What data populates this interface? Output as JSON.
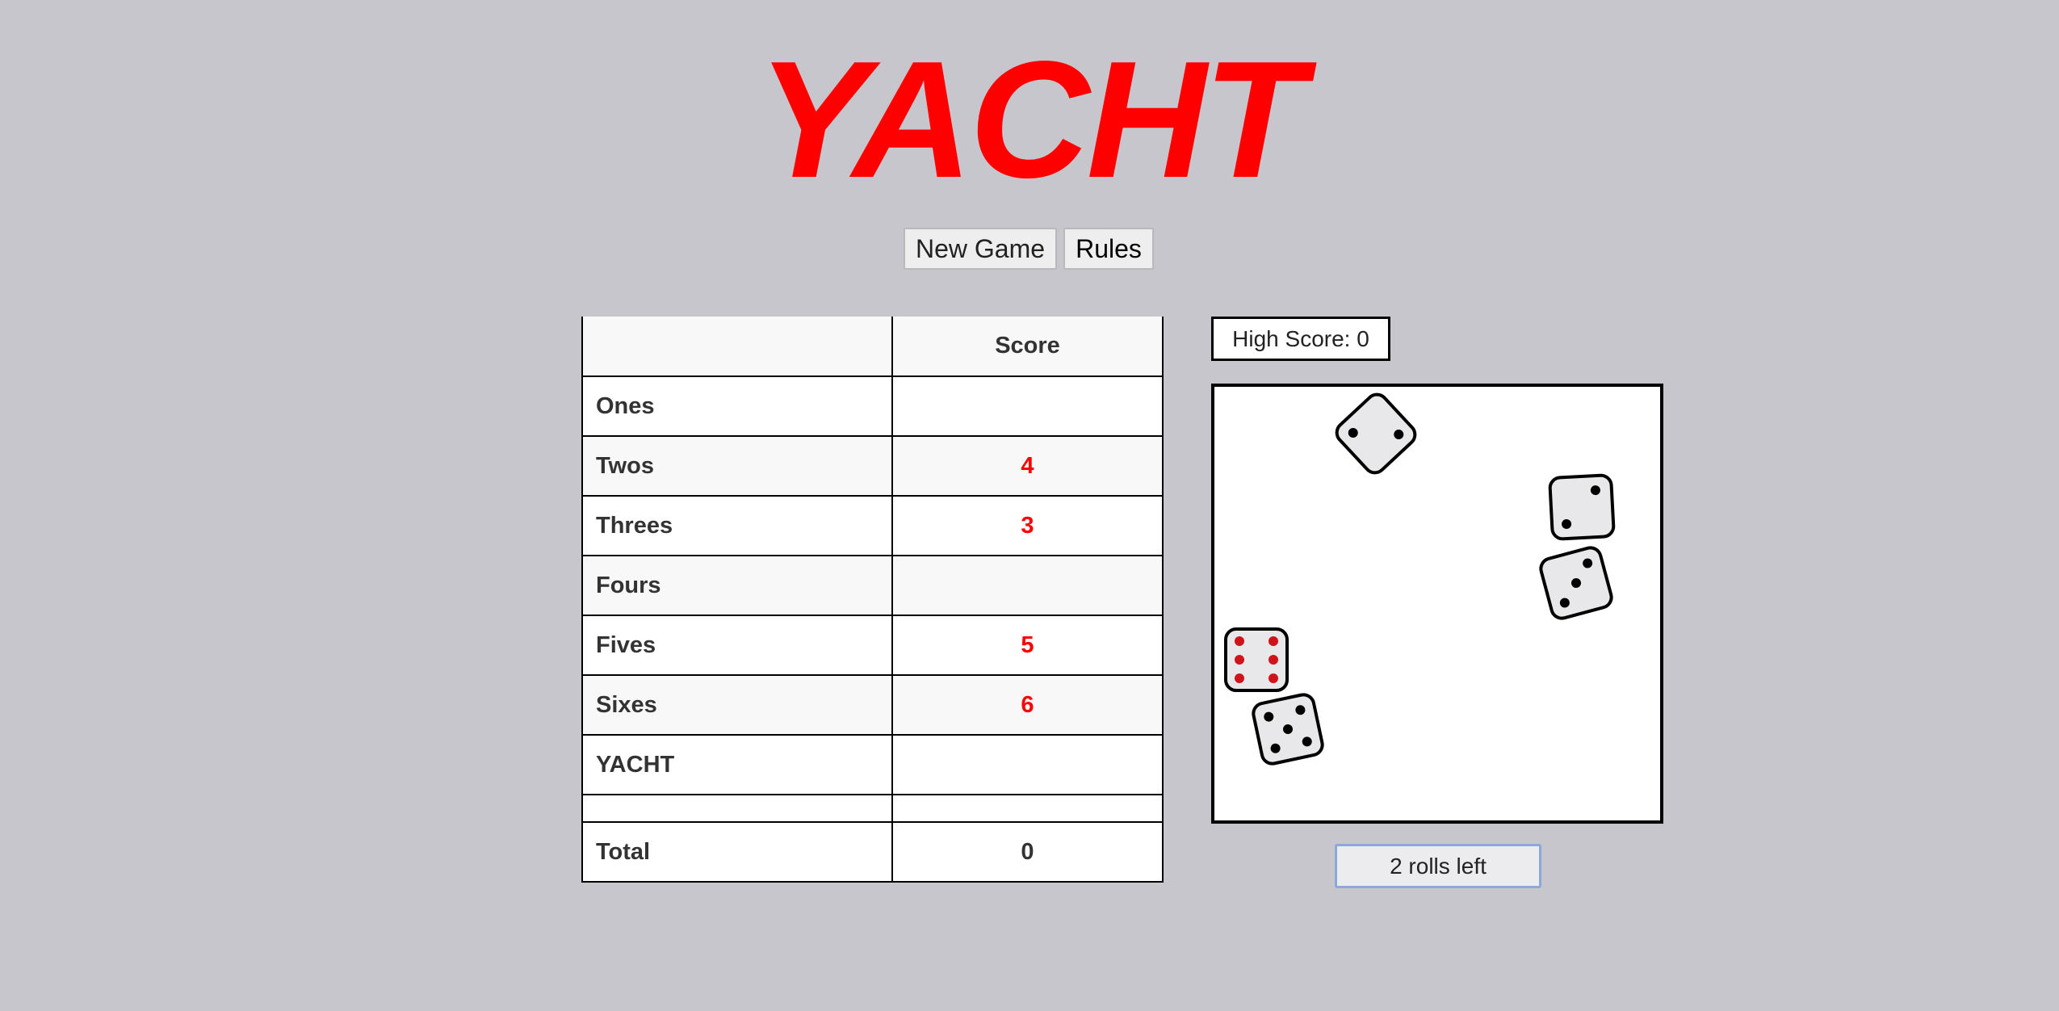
{
  "title": "YACHT",
  "buttons": {
    "new_game": "New Game",
    "rules": "Rules"
  },
  "scorecard": {
    "header": {
      "category": "",
      "score": "Score"
    },
    "rows": [
      {
        "category": "Ones",
        "score": ""
      },
      {
        "category": "Twos",
        "score": "4"
      },
      {
        "category": "Threes",
        "score": "3"
      },
      {
        "category": "Fours",
        "score": ""
      },
      {
        "category": "Fives",
        "score": "5"
      },
      {
        "category": "Sixes",
        "score": "6"
      },
      {
        "category": "YACHT",
        "score": ""
      }
    ],
    "total": {
      "category": "Total",
      "score": "0"
    }
  },
  "high_score": "High Score: 0",
  "roll_button": "2 rolls left",
  "dice": [
    {
      "value": 2,
      "held": false
    },
    {
      "value": 2,
      "held": false
    },
    {
      "value": 3,
      "held": false
    },
    {
      "value": 6,
      "held": true
    },
    {
      "value": 5,
      "held": false
    }
  ],
  "colors": {
    "title": "#fe0000",
    "held_pip": "#d0121b",
    "pip": "#000000",
    "score_red": "#fe0000",
    "background": "#c8c6cd"
  }
}
